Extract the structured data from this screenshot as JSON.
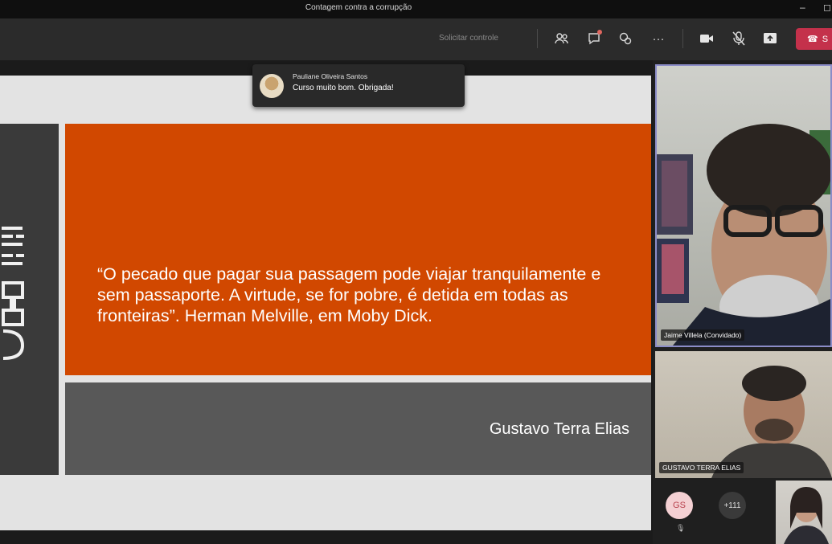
{
  "window": {
    "title": "Contagem contra a corrupção"
  },
  "toolbar": {
    "request_control": "Solicitar controle",
    "leave_label": "S"
  },
  "slide": {
    "quote": "“O pecado que pagar sua passagem pode viajar tranquilamente e sem passaporte. A virtude, se for pobre, é detida em todas as fronteiras”. Herman Melville, em Moby Dick.",
    "author": "Gustavo Terra Elias"
  },
  "toast": {
    "sender": "Pauliane Oliveira Santos",
    "message": "Curso muito bom. Obrigada!"
  },
  "participants": {
    "tile1_name": "Jaime Villela (Convidado)",
    "tile2_name": "GUSTAVO TERRA ELIAS",
    "avatar_initials": "GS",
    "overflow_count": "+111"
  },
  "colors": {
    "slide_accent": "#d14800",
    "leave_button": "#c4314b",
    "active_speaker_border": "#8b8cc7"
  }
}
